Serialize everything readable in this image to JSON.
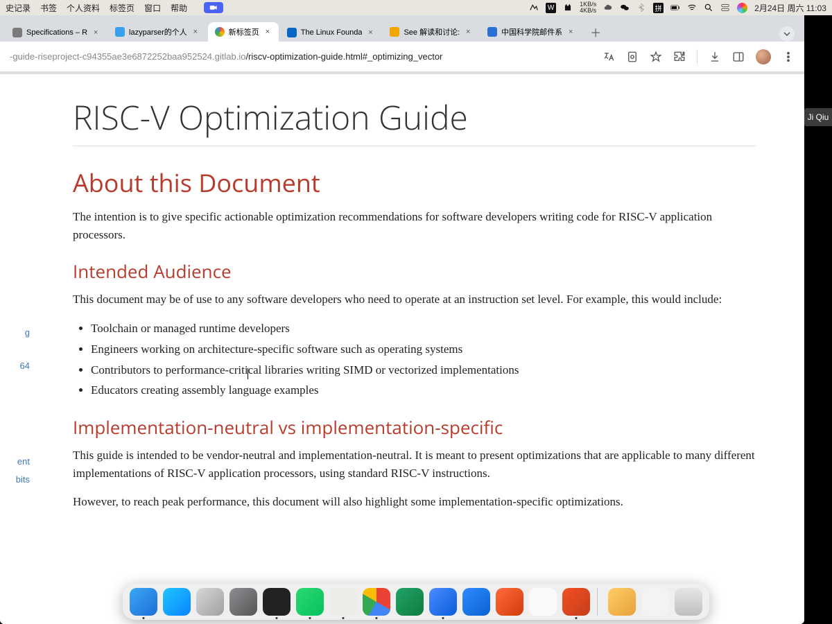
{
  "menubar": {
    "left_items": [
      "史记录",
      "书签",
      "个人资料",
      "标签页",
      "窗口",
      "帮助"
    ],
    "netstat": "1KB/s\n4KB/s",
    "clock": "2月24日 周六 11:03"
  },
  "tabs": [
    {
      "title": "Specifications – R",
      "color": "#9aa"
    },
    {
      "title": "lazyparser的个人",
      "color": "#39a0ed"
    },
    {
      "title": "新标签页",
      "color": "#888"
    },
    {
      "title": "The Linux Founda",
      "color": "#0a66c2"
    },
    {
      "title": "See 解读和讨论:",
      "color": "#f0a500"
    },
    {
      "title": "中国科学院邮件系",
      "color": "#2a6fd6"
    }
  ],
  "url": {
    "domain": "-guide-riseproject-c94355ae3e6872252baa952524.gitlab.io",
    "path": "/riscv-optimization-guide.html#_optimizing_vector"
  },
  "sidecard": "Ji Qiu",
  "toc_frag": [
    "g",
    "64",
    "ent",
    "bits"
  ],
  "doc": {
    "h1": "RISC-V Optimization Guide",
    "h2_about": "About this Document",
    "p_about": "The intention is to give specific actionable optimization recommendations for software developers writing code for RISC-V application processors.",
    "h3_aud": "Intended Audience",
    "p_aud": "This document may be of use to any software developers who need to operate at an instruction set level. For example, this would include:",
    "aud_items": [
      "Toolchain or managed runtime developers",
      "Engineers working on architecture-specific software such as operating systems",
      "Contributors to performance-critical libraries writing SIMD or vectorized implementations",
      "Educators creating assembly language examples"
    ],
    "h3_impl": "Implementation-neutral vs implementation-specific",
    "p_impl1": "This guide is intended to be vendor-neutral and implementation-neutral. It is meant to present optimizations that are applicable to many different implementations of RISC-V application processors, using standard RISC-V instructions.",
    "p_impl2": "However, to reach peak performance, this document will also highlight some implementation-specific optimizations."
  },
  "dock": [
    {
      "name": "finder",
      "bg": "linear-gradient(135deg,#3ba7f5,#1d6fd6)",
      "run": true
    },
    {
      "name": "app-store",
      "bg": "linear-gradient(135deg,#1ec6ff,#0a84ff)",
      "run": false
    },
    {
      "name": "launchpad",
      "bg": "linear-gradient(135deg,#d7d7d7,#a0a0a0)",
      "run": false
    },
    {
      "name": "settings",
      "bg": "linear-gradient(135deg,#8e8e93,#555)",
      "run": false
    },
    {
      "name": "terminal",
      "bg": "#222",
      "run": true
    },
    {
      "name": "wechat",
      "bg": "linear-gradient(135deg,#2bd96f,#07c160)",
      "run": true
    },
    {
      "name": "slack",
      "bg": "#ecece8",
      "run": true
    },
    {
      "name": "chrome",
      "bg": "conic-gradient(#ea4335 0 120deg,#4285f4 120deg 210deg,#34a853 210deg 300deg,#fbbc05 300deg 360deg)",
      "run": true
    },
    {
      "name": "excel",
      "bg": "linear-gradient(135deg,#21a366,#107c41)",
      "run": false
    },
    {
      "name": "zoom",
      "bg": "linear-gradient(135deg,#4a8cff,#0b5cdb)",
      "run": true
    },
    {
      "name": "tencent-meeting",
      "bg": "linear-gradient(135deg,#2e8bff,#0a62d0)",
      "run": false
    },
    {
      "name": "wps",
      "bg": "linear-gradient(135deg,#ff6a3d,#d23c0a)",
      "run": false
    },
    {
      "name": "textedit",
      "bg": "#fafafa",
      "run": false
    },
    {
      "name": "powerpoint",
      "bg": "linear-gradient(135deg,#f25022,#c43e1c)",
      "run": true
    },
    {
      "name": "folder",
      "bg": "linear-gradient(135deg,#ffcc66,#e8a23a)",
      "run": false
    },
    {
      "name": "file",
      "bg": "#f3f3f3",
      "run": false
    },
    {
      "name": "trash",
      "bg": "linear-gradient(180deg,#e6e6e6,#bfbfbf)",
      "run": false
    }
  ]
}
